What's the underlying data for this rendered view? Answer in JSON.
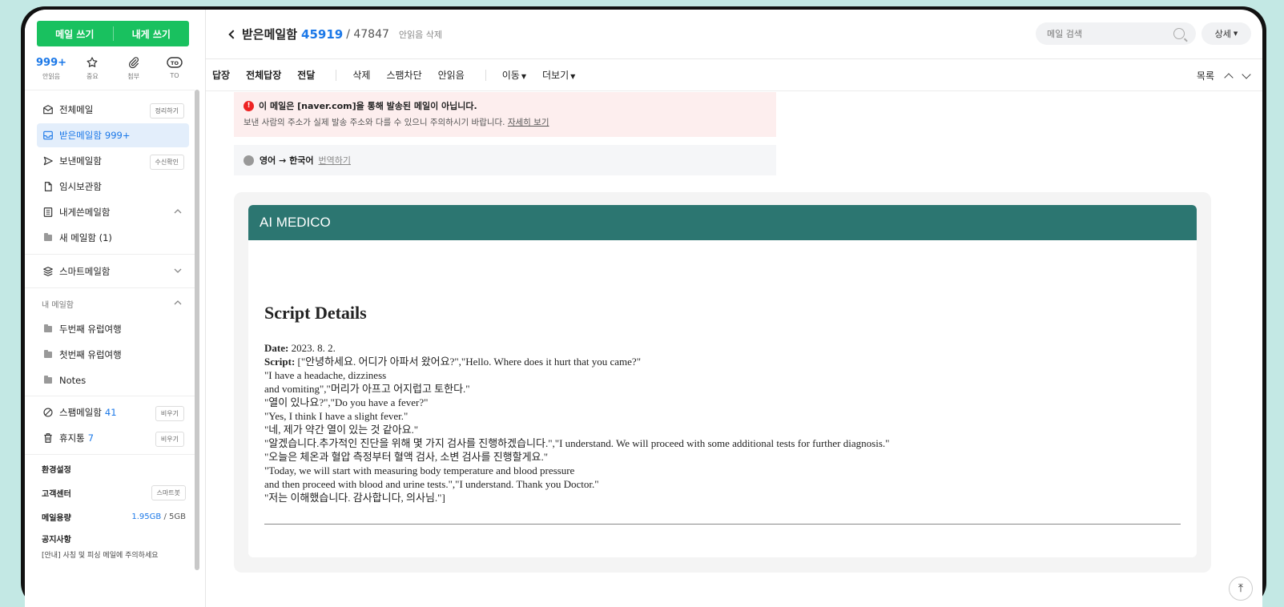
{
  "sidebar": {
    "compose": {
      "write": "메일 쓰기",
      "to_self": "내게 쓰기"
    },
    "quick": [
      {
        "top": "999+",
        "label": "안읽음"
      },
      {
        "label": "중요"
      },
      {
        "label": "첨부"
      },
      {
        "label": "TO"
      }
    ],
    "menu": [
      {
        "label": "전체메일",
        "tag": "정리하기"
      },
      {
        "label": "받은메일함",
        "count": "999+"
      },
      {
        "label": "보낸메일함",
        "tag": "수신확인"
      },
      {
        "label": "임시보관함"
      },
      {
        "label": "내게쓴메일함"
      },
      {
        "label": "새 메일함 (1)"
      }
    ],
    "smart": {
      "label": "스마트메일함"
    },
    "my_mail": {
      "header": "내 메일함",
      "folders": [
        "두번째 유럽여행",
        "첫번째 유럽여행",
        "Notes"
      ]
    },
    "spam": {
      "label": "스팸메일함",
      "count": "41",
      "tag": "비우기"
    },
    "trash": {
      "label": "휴지통",
      "count": "7",
      "tag": "비우기"
    },
    "bottom": {
      "settings": "환경설정",
      "support": "고객센터",
      "support_tag": "스마트봇",
      "quota_label": "메일용량",
      "quota_used": "1.95GB",
      "quota_sep": "/",
      "quota_total": "5GB",
      "notice": "공지사항",
      "notice_text": "[안내] 사칭 및 피싱 메일에 주의하세요"
    }
  },
  "header": {
    "title": "받은메일함",
    "unread": "45919",
    "total": "/ 47847",
    "delete_unread": "안읽음 삭제",
    "search_placeholder": "메일 검색",
    "detail": "상세"
  },
  "toolbar": {
    "reply": "답장",
    "reply_all": "전체답장",
    "forward": "전달",
    "delete": "삭제",
    "block_spam": "스팸차단",
    "mark_unread": "안읽음",
    "move": "이동",
    "more": "더보기",
    "list": "목록"
  },
  "warning": {
    "title": "이 메일은 [naver.com]을 통해 발송된 메일이 아닙니다.",
    "body": "보낸 사람의 주소가 실제 발송 주소와 다를 수 있으니 주의하시기 바랍니다.",
    "link": "자세히 보기"
  },
  "translate": {
    "label": "영어 → 한국어",
    "link": "번역하기"
  },
  "mail": {
    "brand": "AI MEDICO",
    "heading": "Script Details",
    "date_label": "Date:",
    "date_value": "2023. 8. 2.",
    "script_label": "Script:",
    "script_first": "[\"안녕하세요. 어디가 아파서 왔어요?\",\"Hello. Where does it hurt that you came?\"",
    "script_lines": [
      "\"I have a headache, dizziness",
      "and vomiting\",\"머리가 아프고 어지럽고 토한다.\"",
      "\"열이 있나요?\",\"Do you have a fever?\"",
      "\"Yes, I think I have a slight fever.\"",
      "\"네, 제가 약간 열이 있는 것 같아요.\"",
      "\"알겠습니다.추가적인 진단을 위해 몇 가지 검사를 진행하겠습니다.\",\"I understand. We will proceed with some additional tests for further diagnosis.\"",
      "\"오늘은 체온과 혈압 측정부터 혈액 검사, 소변 검사를 진행할게요.\"",
      "\"Today, we will start with measuring body temperature and blood pressure",
      "and then proceed with blood and urine tests.\",\"I understand. Thank you Doctor.\"",
      "\"저는 이해했습니다. 감사합니다, 의사님.\"]"
    ]
  },
  "colors": {
    "accent": "#19c15f",
    "link": "#1b78e8",
    "mail_header": "#2c7671",
    "warning_bg": "#fdeeee"
  }
}
